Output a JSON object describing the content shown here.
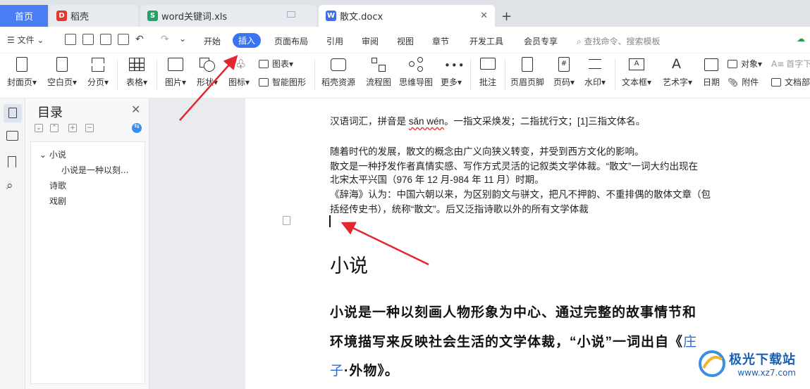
{
  "tabs": {
    "home": "首页",
    "tab1": "稻壳",
    "tab2": "word关键词.xls",
    "tab3": "散文.docx",
    "new_tab": "+"
  },
  "toolbar": {
    "file": "文件",
    "menus": [
      "开始",
      "插入",
      "页面布局",
      "引用",
      "审阅",
      "视图",
      "章节",
      "开发工具",
      "会员专享"
    ],
    "active_menu": "插入",
    "search": "查找命令、搜索模板"
  },
  "ribbon": {
    "cover": "封面页",
    "blank": "空白页",
    "pagebreak": "分页",
    "table": "表格",
    "picture": "图片",
    "shape": "形状",
    "icon": "图标",
    "chart": "图表",
    "smartart": "智能图形",
    "docer": "稻壳资源",
    "flow": "流程图",
    "mind": "思维导图",
    "more": "更多",
    "comment": "批注",
    "header": "页眉页脚",
    "pagenum": "页码",
    "watermark": "水印",
    "textbox": "文本框",
    "wordart": "艺术字",
    "date": "日期",
    "object": "对象",
    "attach": "附件",
    "dropcap": "首字下",
    "docpart": "文档部"
  },
  "nav": {
    "title": "目录",
    "items": [
      "小说",
      "小说是一种以刻...",
      "诗歌",
      "戏剧"
    ]
  },
  "doc": {
    "line1_a": "汉语词汇，拼音是 ",
    "line1_pinyin": "sǎn wén",
    "line1_b": "。一指文采焕发；二指扰行文；[1]三指文体名。",
    "line2": "随着时代的发展，散文的概念由广义向狭义转变，并受到西方文化的影响。",
    "line3": "散文是一种抒发作者真情实感、写作方式灵活的记叙类文学体裁。“散文”一词大约出现在",
    "line4": "北宋太平兴国（976 年 12 月-984 年 11 月）时期。",
    "line5": "《辞海》认为：中国六朝以来，为区别韵文与骈文，把凡不押韵、不重排偶的散体文章（包",
    "line6": "括经传史书），统称“散文”。后又泛指诗歌以外的所有文学体裁",
    "heading": "小说",
    "bold1": "小说是一种以刻画人物形象为中心、通过完整的故事情节和",
    "bold2_a": "环境描写来反映社会生活的文学体裁，“小说”一词出自《",
    "bold2_link": "庄",
    "bold3_link": "子",
    "bold3_b": "·外物》。"
  },
  "watermark": {
    "brand": "极光下载站",
    "url": "www.xz7.com"
  },
  "colors": {
    "accent": "#3a74f2",
    "arrow": "#e0282e"
  }
}
